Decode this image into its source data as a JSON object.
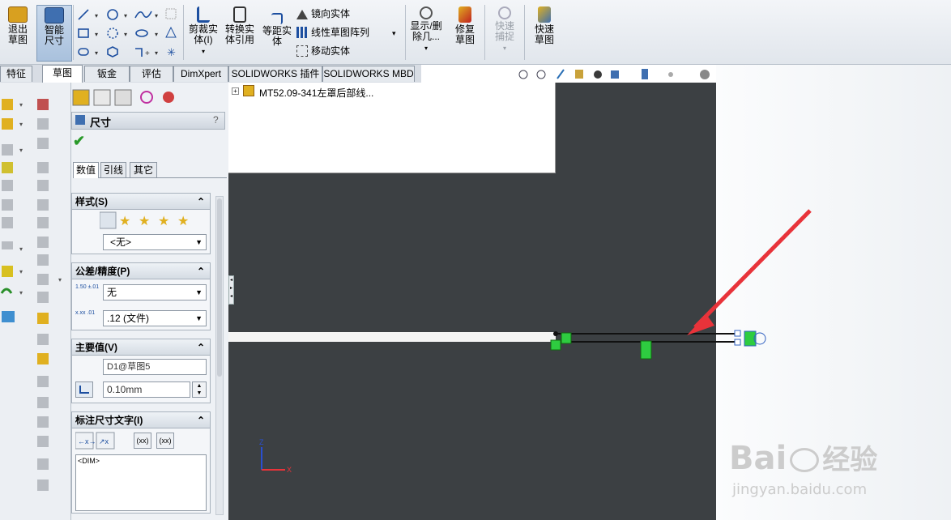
{
  "ribbon": {
    "exit_sketch": "退出草图",
    "smart_dim": "智能尺寸",
    "trim": "剪裁实体(I)",
    "convert": "转换实体引用",
    "offset": "等距实体",
    "mirror": "镜向实体",
    "linear_pattern": "线性草图阵列",
    "move": "移动实体",
    "show_delete": "显示/删除几...",
    "repair": "修复草图",
    "quick_snap": "快速捕捉",
    "rapid_sketch": "快速草图"
  },
  "tabs": [
    "特征",
    "草图",
    "钣金",
    "评估",
    "DimXpert",
    "SOLIDWORKS 插件",
    "SOLIDWORKS MBD"
  ],
  "pm": {
    "title": "尺寸",
    "help": "?",
    "subtabs": [
      "数值",
      "引线",
      "其它"
    ],
    "style_label": "样式(S)",
    "style_value": "<无>",
    "tol_label": "公差/精度(P)",
    "tol_value": "无",
    "prec_value": ".12 (文件)",
    "tol_icon": "1.50 ±.01",
    "prec_icon": "x.xx .01",
    "primary_label": "主要值(V)",
    "primary_name": "D1@草图5",
    "primary_value": "0.10mm",
    "dimtext_label": "标注尺寸文字(I)",
    "dimtext_value": "<DIM>",
    "btn_xx1": "(xx)",
    "btn_xx2": "(xx)"
  },
  "tree": {
    "item": "MT52.09-341左罩后部线..."
  },
  "triad": {
    "z": "Z",
    "x": "X"
  },
  "watermark": {
    "brand": "Bai",
    "brand2": "经验",
    "url": "jingyan.baidu.com"
  },
  "colors": {
    "viewport": "#3c4043",
    "accent_arrow": "#e8333a",
    "sketch_green": "#2ecc40"
  }
}
